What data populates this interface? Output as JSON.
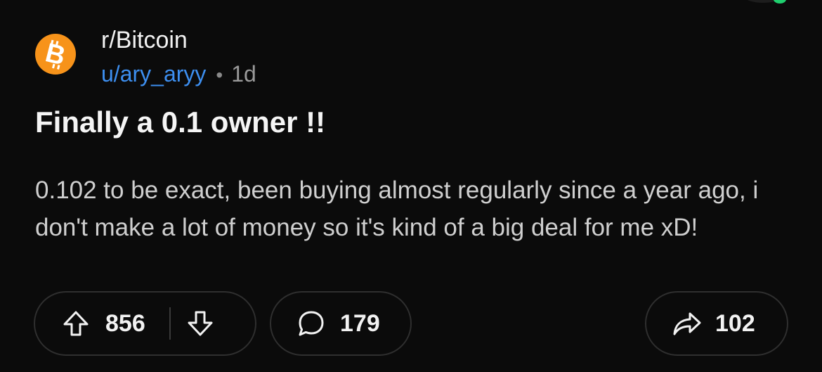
{
  "post": {
    "subreddit": "r/Bitcoin",
    "username": "u/ary_aryy",
    "separator": "•",
    "age": "1d",
    "title": "Finally a 0.1 owner !!",
    "body": "0.102 to be exact, been buying almost regularly since a year ago, i don't make a lot of money so it's kind of a big deal for me xD!"
  },
  "actions": {
    "upvotes": "856",
    "comments": "179",
    "shares": "102"
  },
  "icons": {
    "subreddit_icon": "bitcoin-logo-icon",
    "upvote": "arrow-up-icon",
    "downvote": "arrow-down-icon",
    "comment": "speech-bubble-icon",
    "share": "share-arrow-icon"
  },
  "colors": {
    "background": "#0b0b0b",
    "username": "#3d8ff0",
    "bitcoin_orange": "#f7931a"
  }
}
